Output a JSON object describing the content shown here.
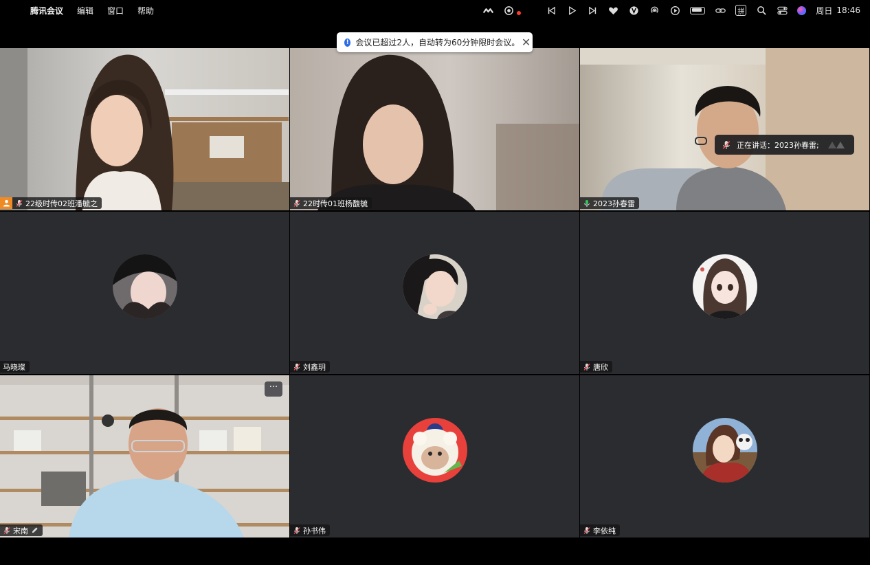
{
  "menubar": {
    "app_name": "腾讯会议",
    "menus": [
      "编辑",
      "窗口",
      "帮助"
    ],
    "clock_day": "周日",
    "clock_time": "18:46",
    "ime_label": "拼",
    "status_icons": [
      "tencent-meeting-icon",
      "screen-record-icon",
      "prev-track-icon",
      "play-icon",
      "next-track-icon",
      "heart-icon",
      "vpn-icon",
      "airdrop-icon",
      "play-circle-icon",
      "battery-icon",
      "link-icon",
      "ime-icon",
      "search-icon",
      "control-center-icon",
      "siri-icon"
    ]
  },
  "toast": {
    "message": "会议已超过2人，自动转为60分钟限时会议。"
  },
  "speaking_tip": {
    "text": "正在讲话：2023孙春雷;"
  },
  "participants": [
    {
      "name": "22级时传02班潘毓之",
      "mode": "video",
      "is_host": true,
      "mic": "muted"
    },
    {
      "name": "22时传01班杨馥毓",
      "mode": "video",
      "mic": "muted"
    },
    {
      "name": "2023孙春雷",
      "mode": "video",
      "mic": "speaking",
      "speaking": true
    },
    {
      "name": "马晓璨",
      "mode": "avatar",
      "mic": "none"
    },
    {
      "name": "刘鑫玥",
      "mode": "avatar",
      "mic": "muted"
    },
    {
      "name": "唐欣",
      "mode": "avatar",
      "mic": "muted"
    },
    {
      "name": "宋南",
      "mode": "video",
      "mic": "muted",
      "editable": true
    },
    {
      "name": "孙书伟",
      "mode": "avatar",
      "mic": "muted"
    },
    {
      "name": "李依纯",
      "mode": "avatar",
      "mic": "muted"
    }
  ],
  "colors": {
    "tile_bg": "#2b2c30",
    "speaking_border": "#30c25a",
    "host_badge": "#f08a24",
    "muted_mic": "#ff4d4f"
  }
}
